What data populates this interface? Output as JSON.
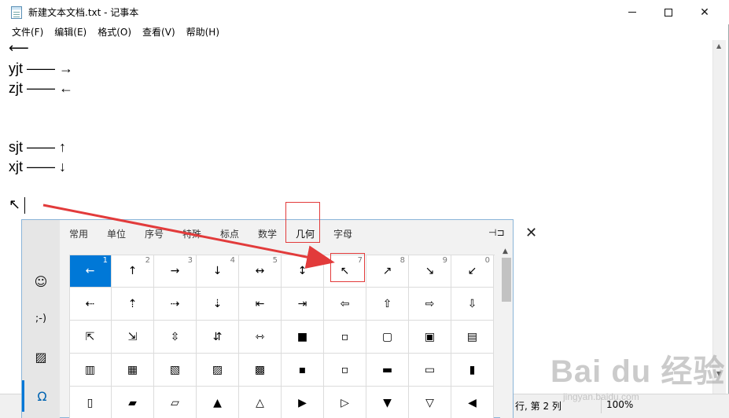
{
  "window": {
    "title": "新建文本文档.txt - 记事本",
    "close_glyph": "✕"
  },
  "menu": [
    "文件(F)",
    "编辑(E)",
    "格式(O)",
    "查看(V)",
    "帮助(H)"
  ],
  "editor": {
    "lines": [
      "⟵",
      "yjt —— →",
      "zjt —— ←",
      "",
      "",
      "sjt —— ↑",
      "xjt —— ↓",
      "",
      "↖"
    ]
  },
  "status": {
    "position": "行, 第 2 列",
    "zoom": "100%"
  },
  "panel": {
    "side": [
      {
        "glyph": "☺",
        "icon": "smiley-icon"
      },
      {
        "glyph": ";-)",
        "icon": "kaomoji-icon"
      },
      {
        "glyph": "▨",
        "icon": "image-icon"
      },
      {
        "glyph": "Ω",
        "icon": "omega-symbol-icon"
      }
    ],
    "tabs": [
      "常用",
      "单位",
      "序号",
      "特殊",
      "标点",
      "数学",
      "几何",
      "字母"
    ],
    "selected_tab": "几何",
    "pin_glyph": "⊣⊐",
    "close_glyph": "✕",
    "rows": [
      [
        [
          "←",
          "1"
        ],
        [
          "↑",
          "2"
        ],
        [
          "→",
          "3"
        ],
        [
          "↓",
          "4"
        ],
        [
          "↔",
          "5"
        ],
        [
          "↕",
          "6"
        ],
        [
          "↖",
          "7"
        ],
        [
          "↗",
          "8"
        ],
        [
          "↘",
          "9"
        ],
        [
          "↙",
          "0"
        ]
      ],
      [
        [
          "⇠",
          ""
        ],
        [
          "⇡",
          ""
        ],
        [
          "⇢",
          ""
        ],
        [
          "⇣",
          ""
        ],
        [
          "⇤",
          ""
        ],
        [
          "⇥",
          ""
        ],
        [
          "⇦",
          ""
        ],
        [
          "⇧",
          ""
        ],
        [
          "⇨",
          ""
        ],
        [
          "⇩",
          ""
        ]
      ],
      [
        [
          "⇱",
          ""
        ],
        [
          "⇲",
          ""
        ],
        [
          "⇳",
          ""
        ],
        [
          "⇵",
          ""
        ],
        [
          "⇿",
          ""
        ],
        [
          "■",
          ""
        ],
        [
          "▫",
          ""
        ],
        [
          "▢",
          ""
        ],
        [
          "▣",
          ""
        ],
        [
          "▤",
          ""
        ]
      ],
      [
        [
          "▥",
          ""
        ],
        [
          "▦",
          ""
        ],
        [
          "▧",
          ""
        ],
        [
          "▨",
          ""
        ],
        [
          "▩",
          ""
        ],
        [
          "▪",
          ""
        ],
        [
          "▫",
          ""
        ],
        [
          "▬",
          ""
        ],
        [
          "▭",
          ""
        ],
        [
          "▮",
          ""
        ]
      ],
      [
        [
          "▯",
          ""
        ],
        [
          "▰",
          ""
        ],
        [
          "▱",
          ""
        ],
        [
          "▲",
          ""
        ],
        [
          "△",
          ""
        ],
        [
          "▶",
          ""
        ],
        [
          "▷",
          ""
        ],
        [
          "▼",
          ""
        ],
        [
          "▽",
          ""
        ],
        [
          "◀",
          ""
        ]
      ]
    ]
  },
  "watermark": {
    "brand": "Bai du 经验",
    "url": "jingyan.baidu.com"
  }
}
